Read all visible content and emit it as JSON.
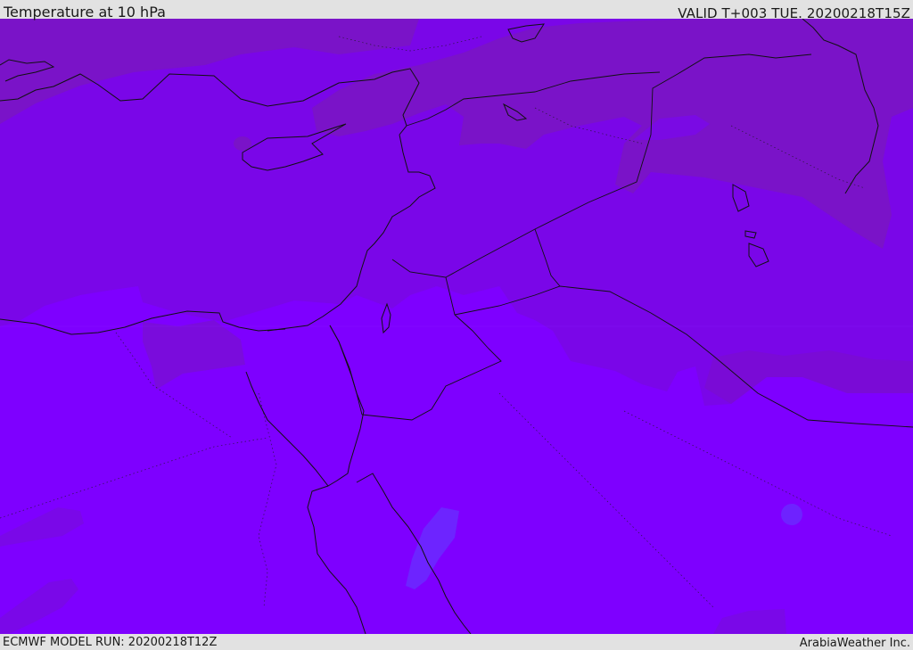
{
  "header": {
    "title": "Temperature at 10 hPa",
    "valid": "VALID T+003 TUE. 20200218T15Z"
  },
  "footer": {
    "model_run": "ECMWF MODEL RUN: 20200218T12Z",
    "credit": "ArabiaWeather Inc."
  },
  "map": {
    "variable": "temperature",
    "level": "10 hPa",
    "region": "Eastern Mediterranean / Middle East",
    "colors": {
      "cold_zone": "#7e00ff",
      "mid_zone": "#7a06e8",
      "warm_zone": "#7a13c8",
      "cold_blob": "#6a2aff",
      "border_line": "#1a1a1a",
      "background": "#e2e2e2"
    }
  }
}
